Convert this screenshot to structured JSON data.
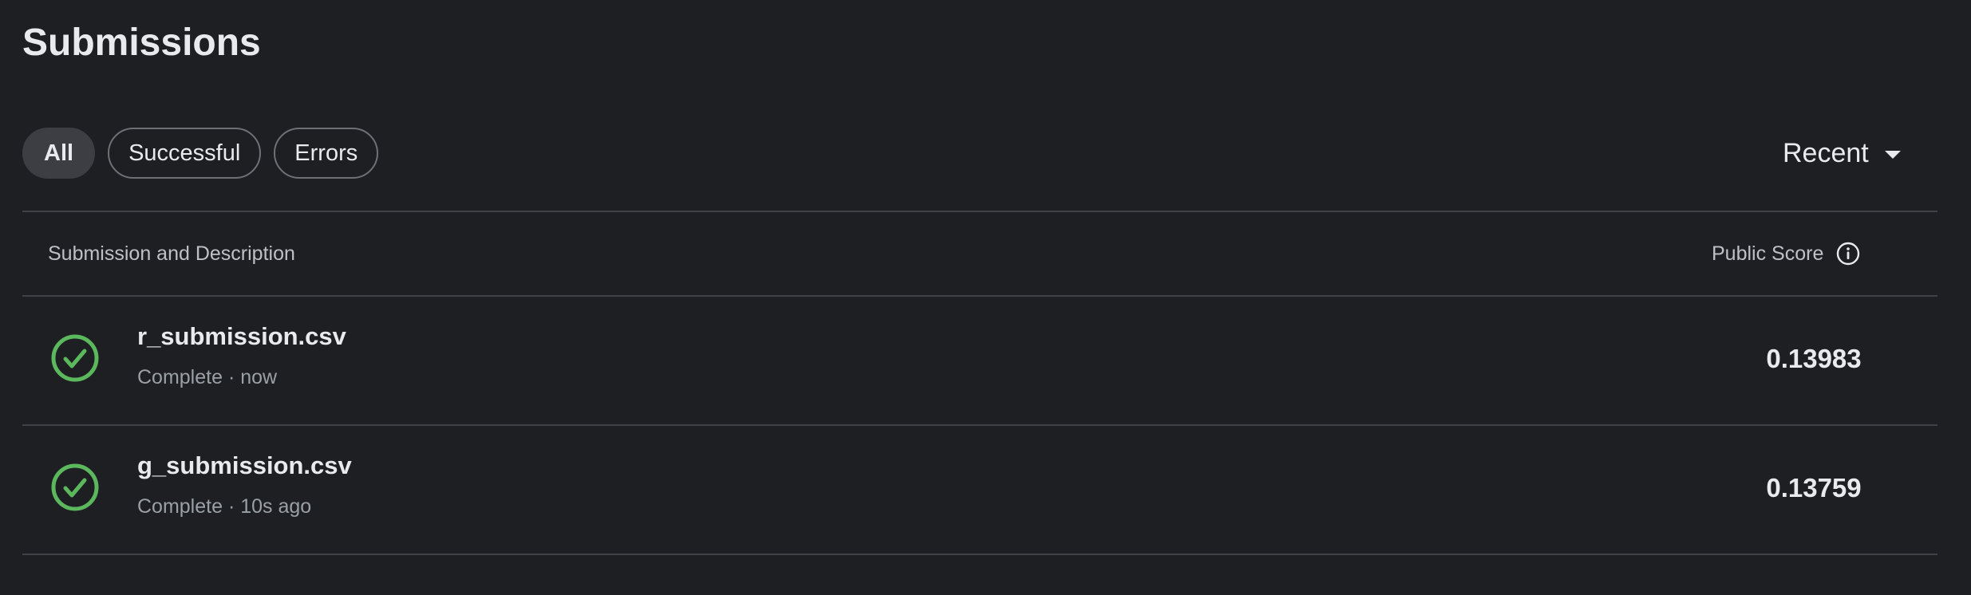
{
  "page": {
    "title": "Submissions"
  },
  "filters": {
    "all": "All",
    "successful": "Successful",
    "errors": "Errors"
  },
  "sort": {
    "label": "Recent",
    "icon": "caret-down-icon"
  },
  "table": {
    "headers": {
      "submission": "Submission and Description",
      "score": "Public Score",
      "score_icon": "info-icon"
    },
    "rows": [
      {
        "status_icon": "check-circle-icon",
        "name": "r_submission.csv",
        "status": "Complete · now",
        "score": "0.13983"
      },
      {
        "status_icon": "check-circle-icon",
        "name": "g_submission.csv",
        "status": "Complete · 10s ago",
        "score": "0.13759"
      }
    ]
  },
  "colors": {
    "background": "#1e1f23",
    "success": "#5cb85c",
    "text": "#e8eaed",
    "muted": "#9aa0a6",
    "divider": "#3f4146"
  }
}
